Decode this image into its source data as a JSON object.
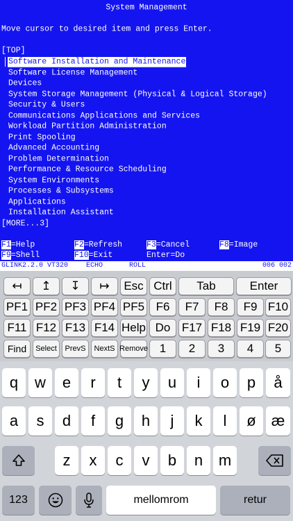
{
  "terminal": {
    "title": "System Management",
    "instruction": "Move cursor to desired item and press Enter.",
    "top_marker": "[TOP]",
    "menu_items": [
      "Software Installation and Maintenance",
      "Software License Management",
      "Devices",
      "System Storage Management (Physical & Logical Storage)",
      "Security & Users",
      "Communications Applications and Services",
      "Workload Partition Administration",
      "Print Spooling",
      "Advanced Accounting",
      "Problem Determination",
      "Performance & Resource Scheduling",
      "System Environments",
      "Processes & Subsystems",
      "Applications",
      "Installation Assistant"
    ],
    "more_marker": "[MORE...3]",
    "fkeys": [
      {
        "num": "F1",
        "label": "=Help"
      },
      {
        "num": "F2",
        "label": "=Refresh"
      },
      {
        "num": "F3",
        "label": "=Cancel"
      },
      {
        "num": "F8",
        "label": "=Image"
      },
      {
        "num": "F9",
        "label": "=Shell"
      },
      {
        "num": "F10",
        "label": "=Exit"
      },
      {
        "num": "",
        "label": "Enter=Do"
      }
    ]
  },
  "status_line": {
    "emulator": "GLINK2.2.0 VT320",
    "echo": "ECHO",
    "roll": "ROLL",
    "position": "006 002"
  },
  "function_panel": {
    "row1": [
      "↤",
      "↥",
      "↧",
      "↦",
      "Esc",
      "Ctrl",
      "Tab",
      "Enter"
    ],
    "row2": [
      "PF1",
      "PF2",
      "PF3",
      "PF4",
      "PF5",
      "F6",
      "F7",
      "F8",
      "F9",
      "F10"
    ],
    "row3": [
      "F11",
      "F12",
      "F13",
      "F14",
      "Help",
      "Do",
      "F17",
      "F18",
      "F19",
      "F20"
    ],
    "row4": [
      "Find",
      "Select",
      "PrevS",
      "NextS",
      "Remove",
      "1",
      "2",
      "3",
      "4",
      "5"
    ]
  },
  "keyboard": {
    "row1": [
      "q",
      "w",
      "e",
      "r",
      "t",
      "y",
      "u",
      "i",
      "o",
      "p",
      "å"
    ],
    "row2": [
      "a",
      "s",
      "d",
      "f",
      "g",
      "h",
      "j",
      "k",
      "l",
      "ø",
      "æ"
    ],
    "row3": [
      "z",
      "x",
      "c",
      "v",
      "b",
      "n",
      "m"
    ],
    "numbers_key": "123",
    "space_key": "mellomrom",
    "return_key": "retur"
  }
}
